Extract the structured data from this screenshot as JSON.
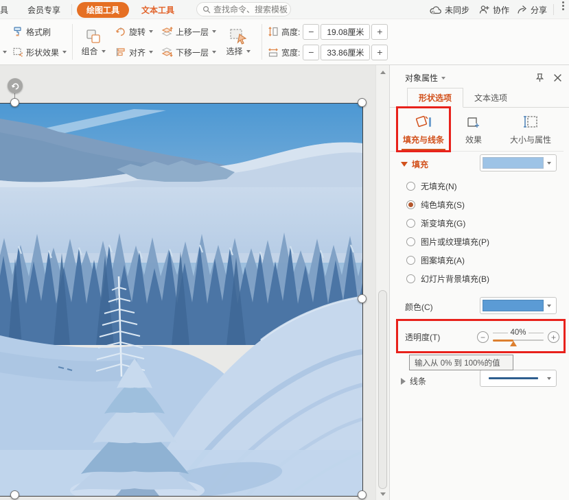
{
  "titlebar": {
    "partial_left": "具",
    "member": "会员专享",
    "draw_tools": "绘图工具",
    "text_tools": "文本工具",
    "search_placeholder": "查找命令、搜索模板",
    "sync_status": "未同步",
    "collaborate": "协作",
    "share": "分享"
  },
  "toolbar": {
    "format_painter": "格式刷",
    "shape_effects": "形状效果",
    "group": "组合",
    "rotate": "旋转",
    "align": "对齐",
    "bring_forward": "上移一层",
    "send_backward": "下移一层",
    "select": "选择",
    "height_label": "高度:",
    "height_value": "19.08厘米",
    "width_label": "宽度:",
    "width_value": "33.86厘米"
  },
  "symbols": {
    "minus": "−",
    "plus": "+"
  },
  "panel": {
    "title": "对象属性",
    "tabs": [
      {
        "label": "形状选项"
      },
      {
        "label": "文本选项"
      }
    ],
    "nav": [
      {
        "label": "填充与线条"
      },
      {
        "label": "效果"
      },
      {
        "label": "大小与属性"
      }
    ],
    "fill_section": "填充",
    "fill_options": [
      {
        "label": "无填充(N)",
        "selected": false
      },
      {
        "label": "纯色填充(S)",
        "selected": true
      },
      {
        "label": "渐变填充(G)",
        "selected": false
      },
      {
        "label": "图片或纹理填充(P)",
        "selected": false
      },
      {
        "label": "图案填充(A)",
        "selected": false
      },
      {
        "label": "幻灯片背景填充(B)",
        "selected": false
      }
    ],
    "color_label": "颜色(C)",
    "transparency_label": "透明度(T)",
    "transparency_value": "40%",
    "transparency_tooltip": "输入从 0% 到 100%的值",
    "line_section": "线条",
    "colors": {
      "fill_swatch": "#9dc3e6",
      "color_swatch": "#5b9bd5",
      "line_preview": "#2e5e8e",
      "accent_orange": "#d2511c",
      "highlight_red": "#e8211b"
    }
  }
}
